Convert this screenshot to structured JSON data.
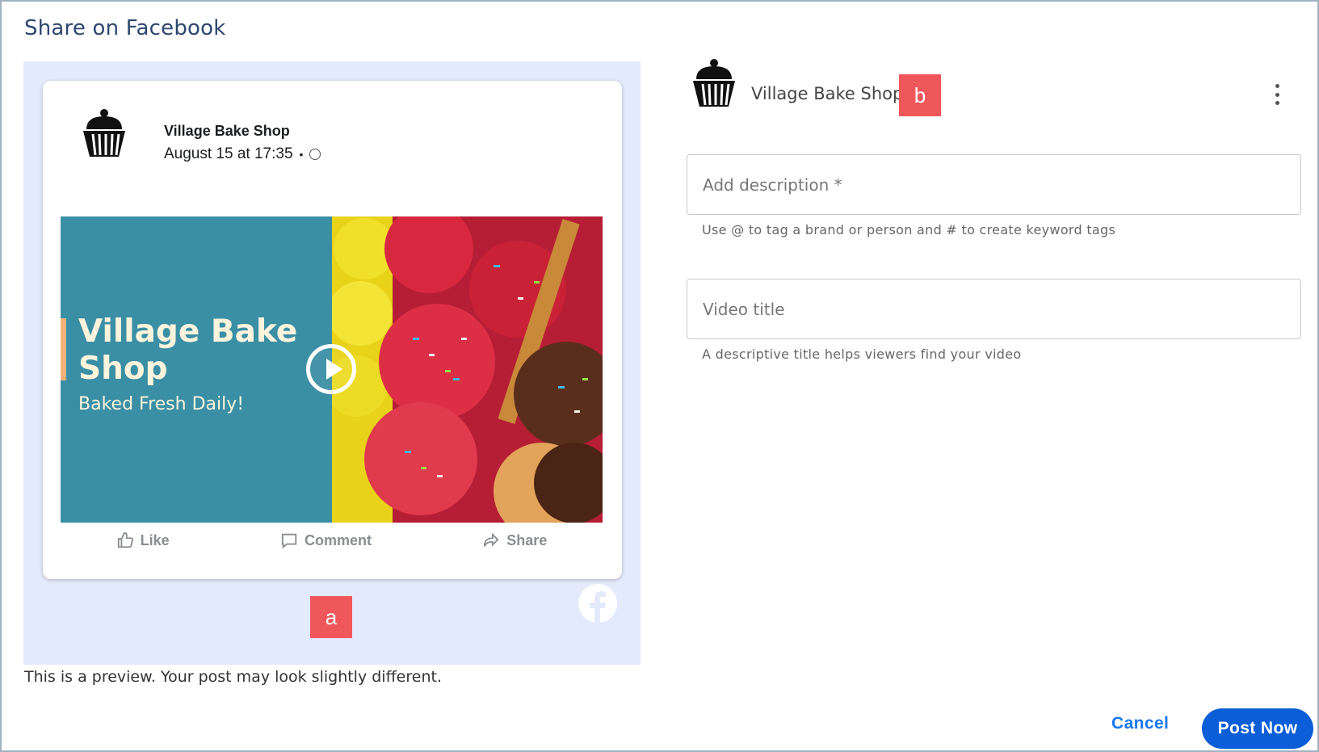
{
  "dialog": {
    "title": "Share on Facebook"
  },
  "preview": {
    "account_name": "Village Bake Shop",
    "timestamp": "August 15 at 17:35",
    "separator": "•",
    "media": {
      "headline": "Village Bake Shop",
      "subheadline": "Baked Fresh Daily!"
    },
    "actions": [
      {
        "label": "Like",
        "icon": "thumbs-up-icon"
      },
      {
        "label": "Comment",
        "icon": "comment-icon"
      },
      {
        "label": "Share",
        "icon": "share-icon"
      }
    ],
    "badge_label": "a",
    "note": "This is a preview. Your post may look slightly different."
  },
  "account": {
    "name": "Village Bake Shop",
    "badge_label": "b"
  },
  "form": {
    "description": {
      "placeholder": "Add description *",
      "helper": "Use @ to tag a brand or person and # to create keyword tags"
    },
    "video_title": {
      "placeholder": "Video title",
      "helper": "A descriptive title helps viewers find your video"
    }
  },
  "footer": {
    "cancel_label": "Cancel",
    "post_label": "Post Now"
  },
  "colors": {
    "brand_blue": "#0b5ed7",
    "link_blue": "#1877f2",
    "badge_red": "#f0575a",
    "preview_bg": "#e3eafb",
    "media_teal": "#3b8fa5"
  }
}
